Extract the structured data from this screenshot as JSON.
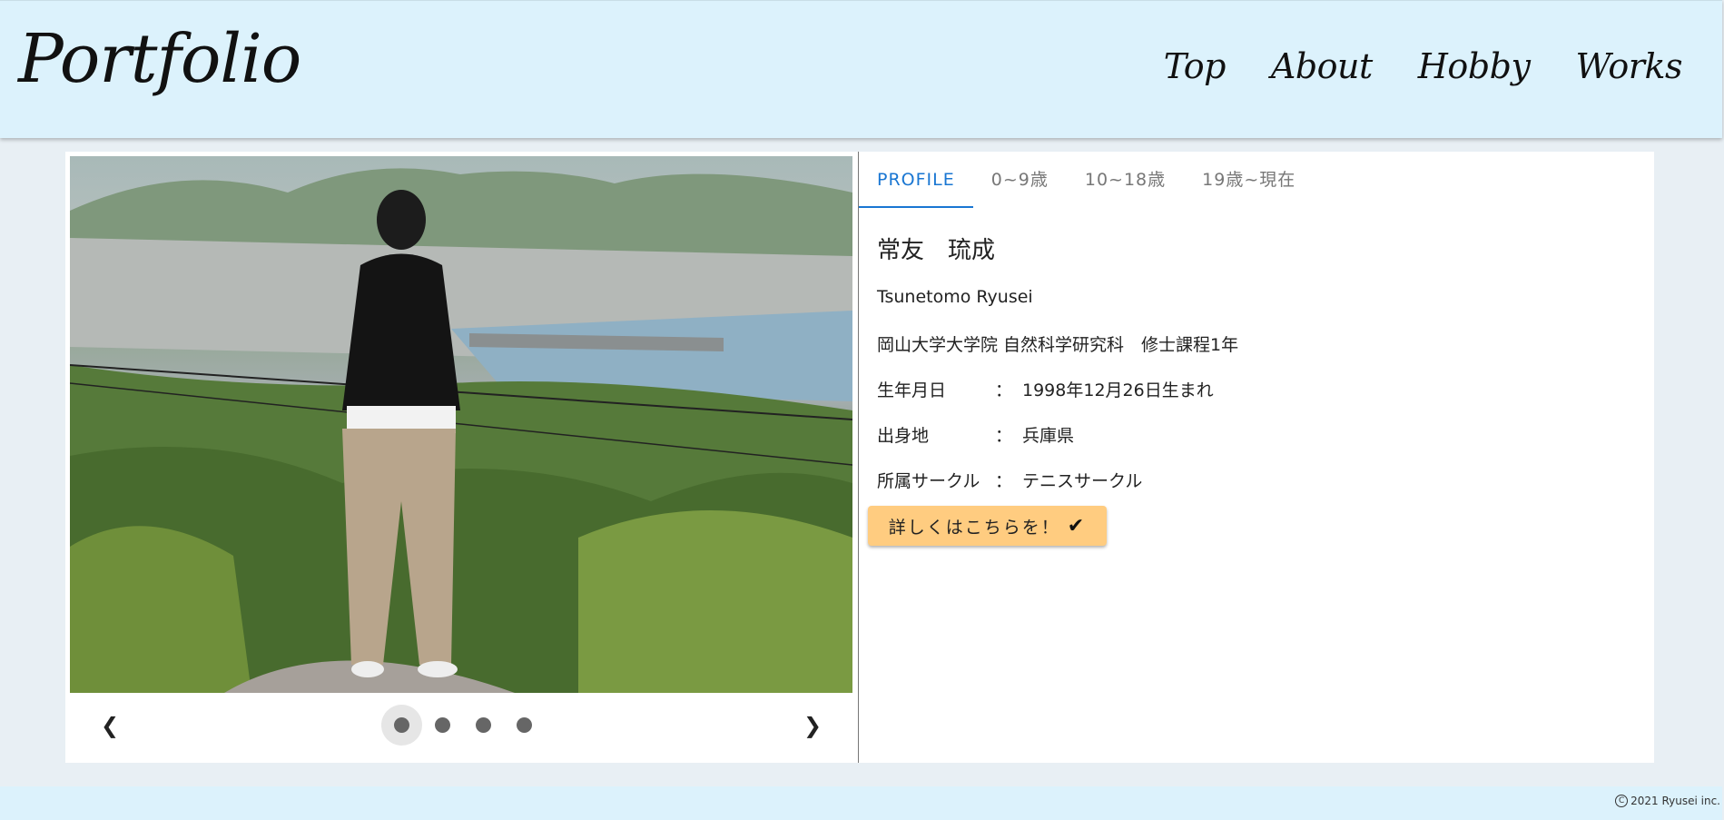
{
  "header": {
    "logo": "Portfolio",
    "nav": [
      "Top",
      "About",
      "Hobby",
      "Works"
    ]
  },
  "carousel": {
    "photo_alt": "Person standing on a rock overlooking a harbor town",
    "prev_icon": "chevron-left-icon",
    "next_icon": "chevron-right-icon",
    "slide_count": 4,
    "active_slide": 1
  },
  "profile": {
    "tabs": [
      "PROFILE",
      "0~9歳",
      "10~18歳",
      "19歳~現在"
    ],
    "active_tab": "PROFILE",
    "name_ja": "常友　琉成",
    "name_en": "Tsunetomo Ryusei",
    "affiliation": "岡山大学大学院 自然科学研究科　修士課程1年",
    "rows": [
      {
        "label": "生年月日",
        "sep": "：",
        "value": "1998年12月26日生まれ"
      },
      {
        "label": "出身地",
        "sep": "：",
        "value": "兵庫県"
      },
      {
        "label": "所属サークル",
        "sep": "：",
        "value": "テニスサークル"
      }
    ],
    "detail_button": "詳しくはこちらを！",
    "button_color": "#ffcc80",
    "accent_color": "#1976d2"
  },
  "footer": {
    "copyright": "2021 Ryusei inc."
  }
}
